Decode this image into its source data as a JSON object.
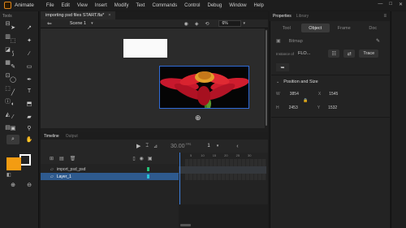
{
  "menubar": {
    "app_name": "Animate",
    "items": [
      "File",
      "Edit",
      "View",
      "Insert",
      "Modify",
      "Text",
      "Commands",
      "Control",
      "Debug",
      "Window",
      "Help"
    ],
    "window_controls": [
      "—",
      "□",
      "✕"
    ]
  },
  "tools": {
    "title": "Tools",
    "stroke_color": "#ffffff",
    "fill_color": "#f39c12"
  },
  "document": {
    "tab_title": "importing psd files START.fla*",
    "tab_close": "×",
    "scene_label": "Scene 1",
    "zoom_value": "6%"
  },
  "timeline": {
    "tabs": [
      "Timeline",
      "Output"
    ],
    "fps": "30.00",
    "fps_unit": "FPS",
    "frame_number": "1",
    "frame_ticks": [
      "5",
      "10",
      "15",
      "20",
      "25",
      "30"
    ],
    "layers": [
      {
        "name": "import_psd_psd",
        "selected": false
      },
      {
        "name": "Layer_1",
        "selected": true
      }
    ]
  },
  "properties": {
    "tabs": [
      "Properties",
      "Library"
    ],
    "subtabs": [
      "Tool",
      "Object",
      "Frame",
      "Doc"
    ],
    "active_subtab": "Object",
    "symbol_type": "Bitmap",
    "instance_of_label": "Instance of",
    "instance_of_value": "FLO...",
    "trace_button": "Trace",
    "position_size_title": "Position and Size",
    "w_label": "W",
    "w_value": "3854",
    "x_label": "X",
    "x_value": "1545",
    "h_label": "H",
    "h_value": "2453",
    "y_label": "Y",
    "y_value": "1532"
  },
  "colors": {
    "accent_blue": "#2f6ad6",
    "fill_orange": "#f39c12",
    "playhead_blue": "#3d7fdc"
  }
}
